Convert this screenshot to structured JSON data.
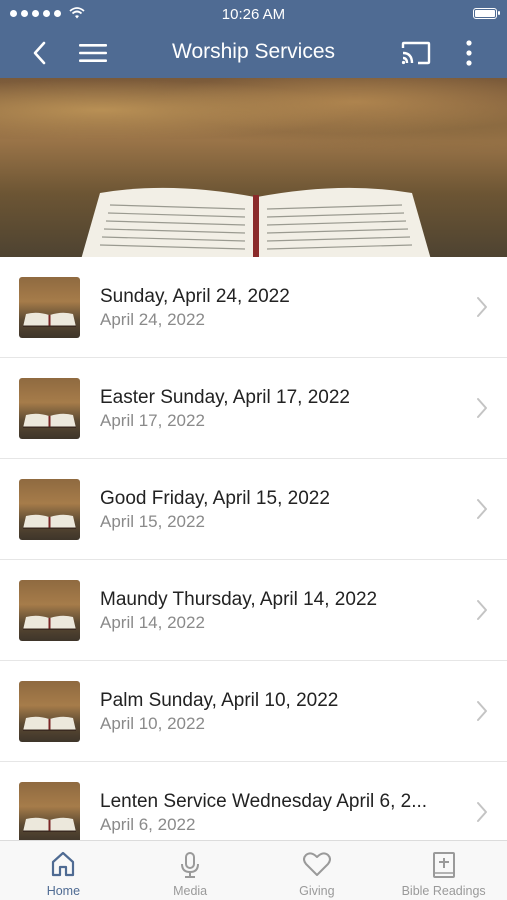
{
  "status_bar": {
    "time": "10:26 AM"
  },
  "nav": {
    "title": "Worship Services"
  },
  "services": [
    {
      "title": "Sunday, April 24, 2022",
      "date": "April 24, 2022"
    },
    {
      "title": "Easter Sunday, April 17, 2022",
      "date": "April 17, 2022"
    },
    {
      "title": "Good Friday, April 15, 2022",
      "date": "April 15, 2022"
    },
    {
      "title": "Maundy Thursday, April 14, 2022",
      "date": "April 14, 2022"
    },
    {
      "title": "Palm Sunday, April 10, 2022",
      "date": "April 10, 2022"
    },
    {
      "title": "Lenten Service Wednesday April 6, 2...",
      "date": "April 6, 2022"
    }
  ],
  "tabs": [
    {
      "label": "Home",
      "icon": "home-icon",
      "active": true
    },
    {
      "label": "Media",
      "icon": "microphone-icon"
    },
    {
      "label": "Giving",
      "icon": "heart-icon"
    },
    {
      "label": "Bible Readings",
      "icon": "bible-icon"
    }
  ],
  "colors": {
    "header": "#4f6b93",
    "active_tab": "#4f6b93",
    "inactive_tab": "#9a9a9a"
  }
}
